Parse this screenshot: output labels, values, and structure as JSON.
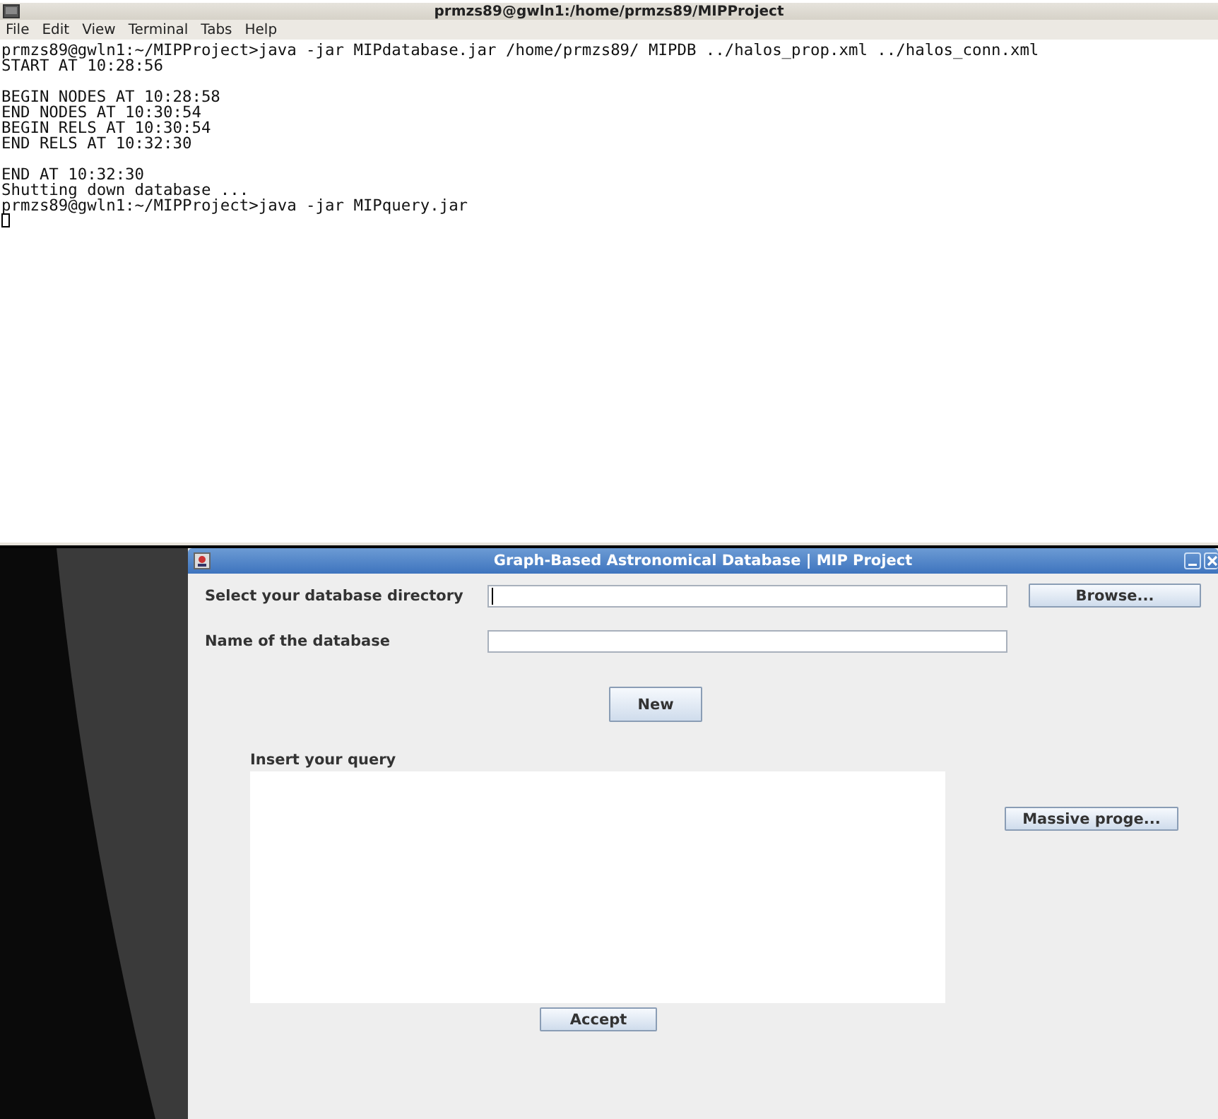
{
  "terminal": {
    "title": "prmzs89@gwln1:/home/prmzs89/MIPProject",
    "menu": [
      "File",
      "Edit",
      "View",
      "Terminal",
      "Tabs",
      "Help"
    ],
    "blocks": [
      [
        "prmzs89@gwln1:~/MIPProject>java -jar MIPdatabase.jar /home/prmzs89/ MIPDB ../halos_prop.xml ../halos_conn.xml",
        "START AT 10:28:56"
      ],
      [
        "BEGIN NODES AT 10:28:58",
        "END NODES AT 10:30:54",
        "BEGIN RELS AT 10:30:54",
        "END RELS AT 10:32:30"
      ],
      [
        "END AT 10:32:30",
        "Shutting down database ...",
        "prmzs89@gwln1:~/MIPProject>java -jar MIPquery.jar"
      ]
    ]
  },
  "app": {
    "title": "Graph-Based Astronomical Database | MIP Project",
    "directory_label": "Select your database directory",
    "directory_focused": true,
    "browse_button": "Browse...",
    "name_label": "Name of the database",
    "new_button": "New",
    "query_label": "Insert your query",
    "massive_button": "Massive proge...",
    "accept_button": "Accept"
  }
}
